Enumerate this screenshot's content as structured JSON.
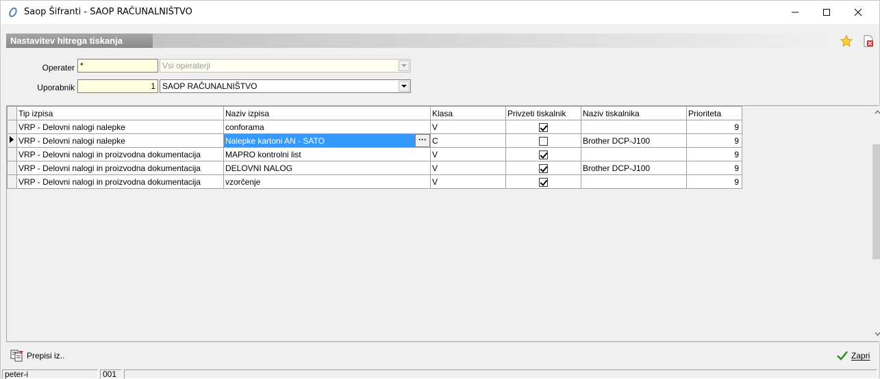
{
  "window": {
    "title": "Saop Šifranti - SAOP RAČUNALNIŠTVO"
  },
  "panel": {
    "title": "Nastavitev hitrega tiskanja"
  },
  "form": {
    "operater": {
      "label": "Operater",
      "code": "*",
      "name": "Vsi operaterji"
    },
    "uporabnik": {
      "label": "Uporabnik",
      "code": "1",
      "name": "SAOP RAČUNALNIŠTVO"
    }
  },
  "grid": {
    "columns": [
      "Tip izpisa",
      "Naziv izpisa",
      "Klasa",
      "Privzeti tiskalnik",
      "Naziv tiskalnika",
      "Prioriteta"
    ],
    "rows": [
      {
        "tip": "VRP - Delovni nalogi nalepke",
        "naziv": "conforama",
        "klasa": "V",
        "privzeti": true,
        "tiskalnik": "",
        "prioriteta": "9"
      },
      {
        "tip": "VRP - Delovni nalogi nalepke",
        "naziv": "Nalepke kartoni AN - SATO",
        "klasa": "C",
        "privzeti": false,
        "tiskalnik": "Brother DCP-J100",
        "prioriteta": "9"
      },
      {
        "tip": "VRP - Delovni nalogi in proizvodna dokumentacija",
        "naziv": "MAPRO kontrolni list",
        "klasa": "V",
        "privzeti": true,
        "tiskalnik": "",
        "prioriteta": "9"
      },
      {
        "tip": "VRP - Delovni nalogi in proizvodna dokumentacija",
        "naziv": " DELOVNI NALOG",
        "klasa": "V",
        "privzeti": true,
        "tiskalnik": "Brother DCP-J100",
        "prioriteta": "9"
      },
      {
        "tip": "VRP - Delovni nalogi in proizvodna dokumentacija",
        "naziv": " vzorčenje",
        "klasa": "V",
        "privzeti": true,
        "tiskalnik": "",
        "prioriteta": "9"
      }
    ],
    "ellipsis": "···"
  },
  "buttons": {
    "prepisi": "Prepisi iz..",
    "zapri": "Zapri"
  },
  "status": {
    "user": "peter-i",
    "code": "001"
  },
  "colors": {
    "selection": "#3399ff",
    "banner": "#9a9a9a",
    "field_yellow": "#ffffe1"
  }
}
